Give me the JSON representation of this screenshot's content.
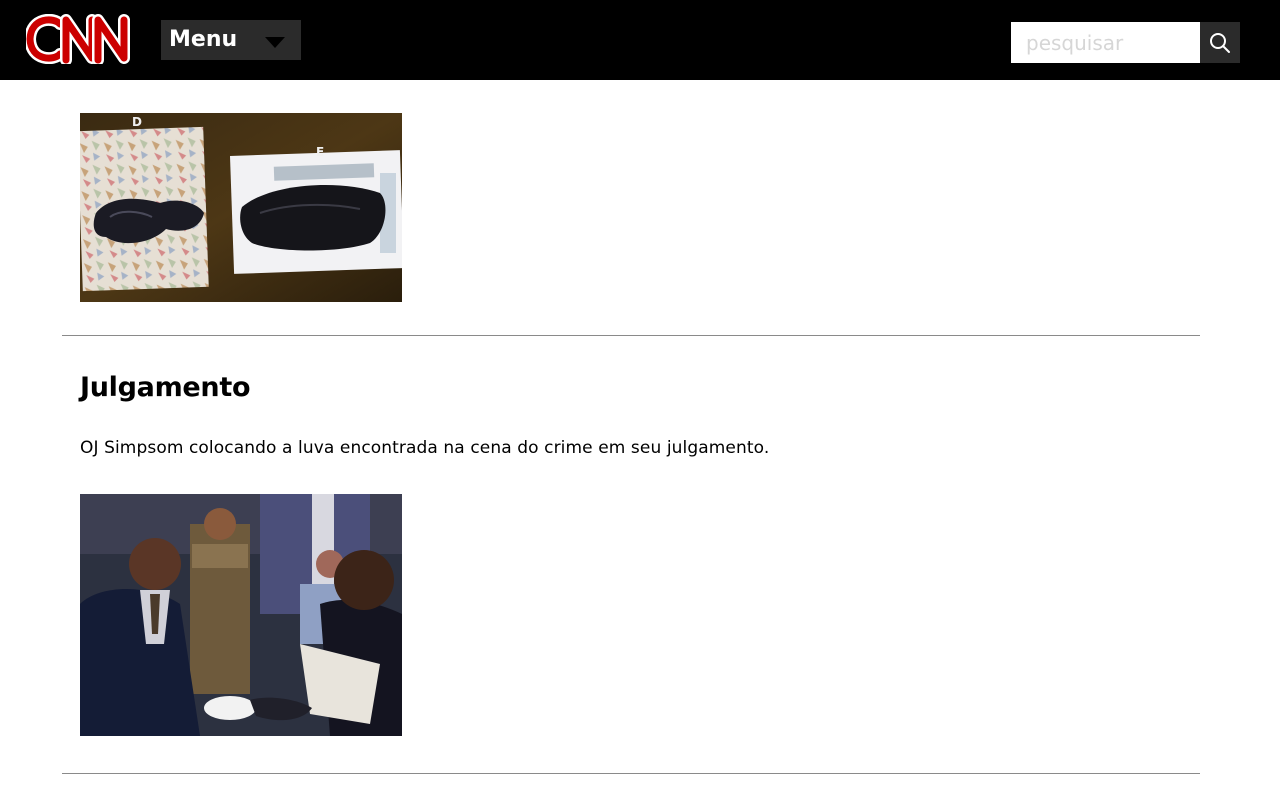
{
  "header": {
    "logo_text": "CNN",
    "menu_label": "Menu",
    "search_placeholder": "pesquisar",
    "background_color": "#000000",
    "logo_color": "#cc0000"
  },
  "main": {
    "section": {
      "title": "Julgamento",
      "text": "OJ Simpsom colocando a luva encontrada na cena do crime em seu julgamento."
    },
    "photo1": {
      "marker_left": "D",
      "marker_right": "E"
    }
  }
}
